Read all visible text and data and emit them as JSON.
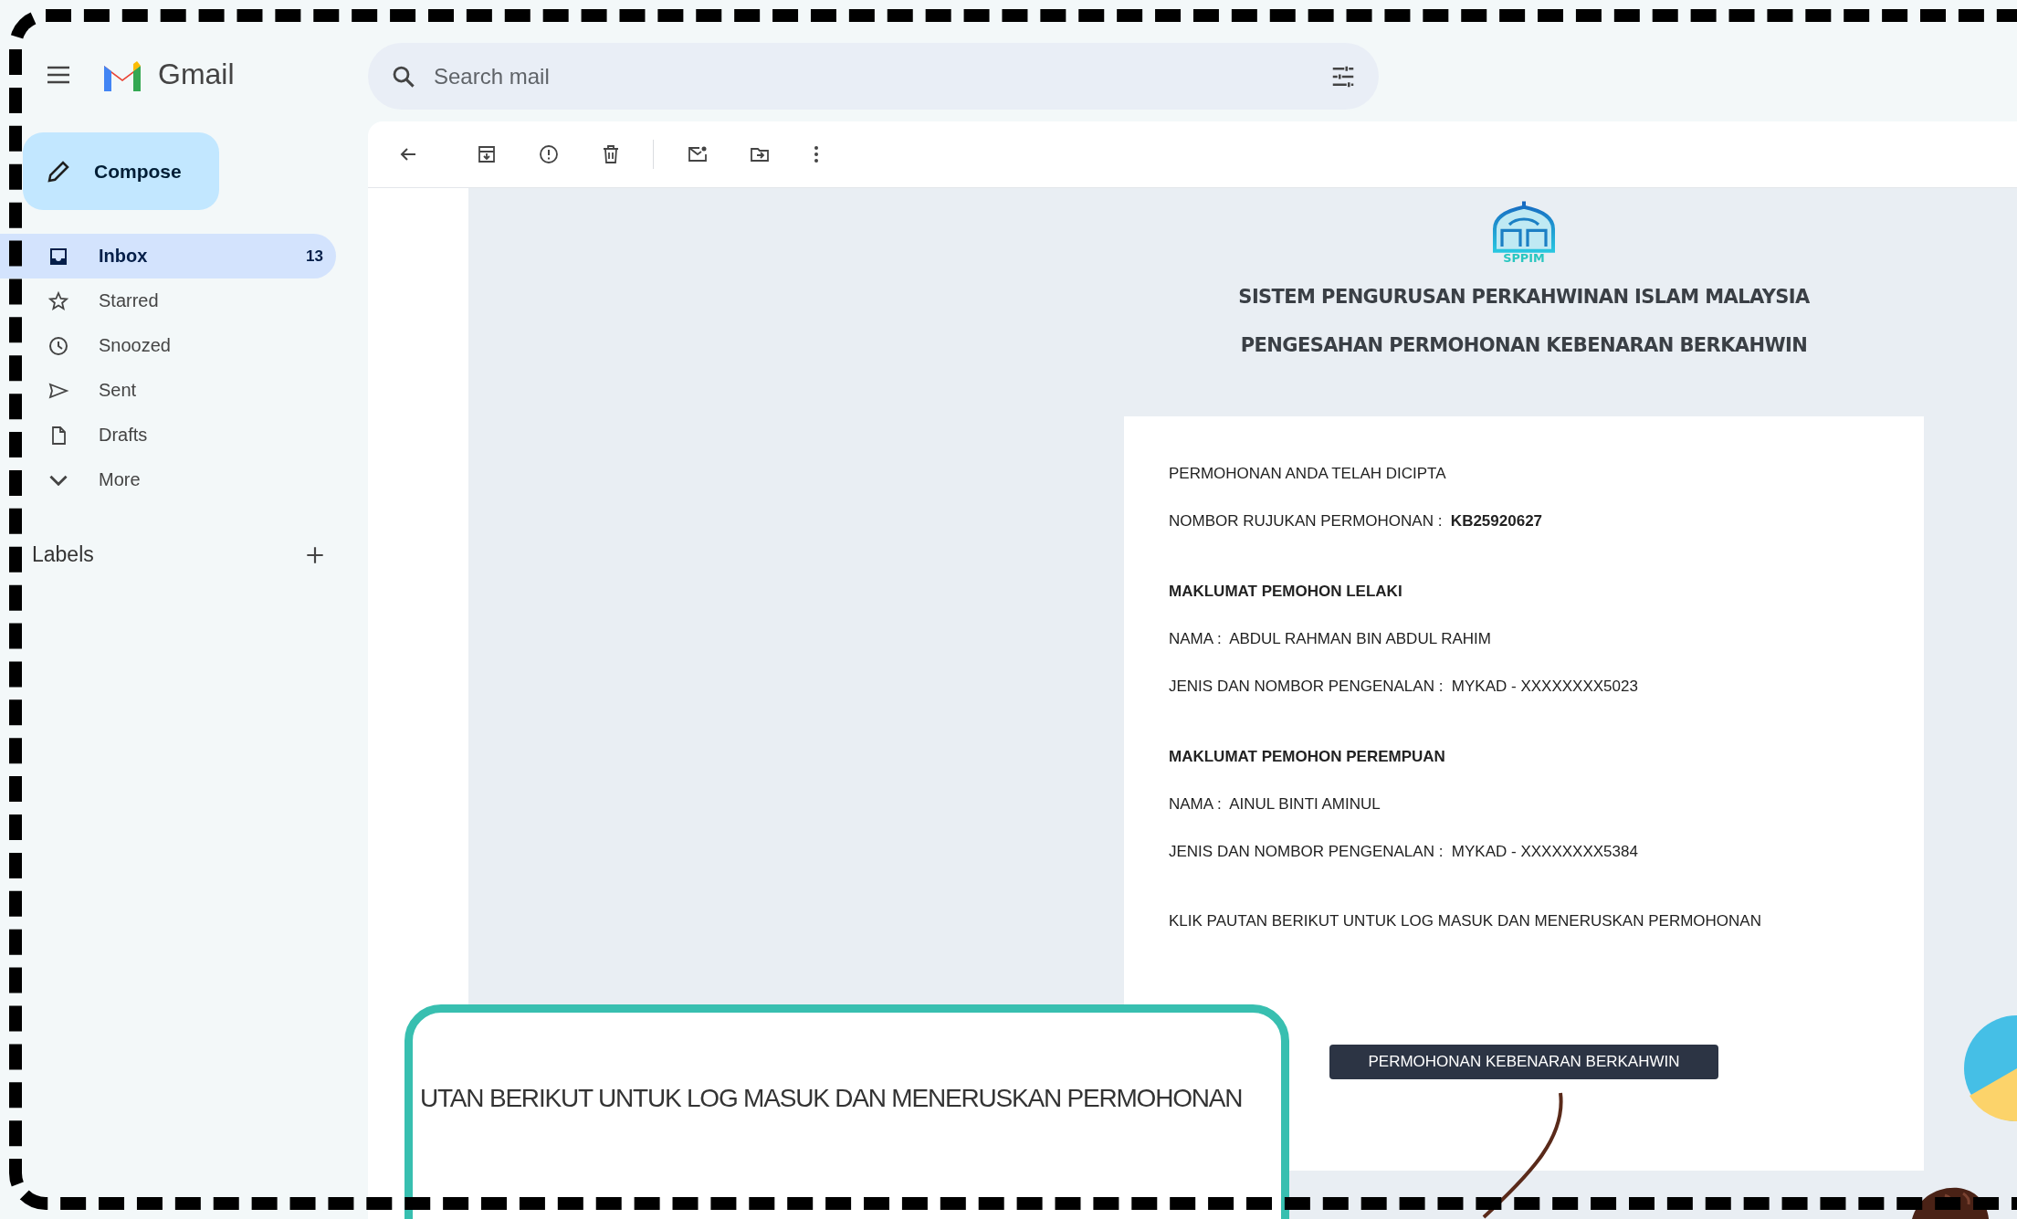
{
  "app": {
    "name": "Gmail"
  },
  "search": {
    "placeholder": "Search mail"
  },
  "compose": {
    "label": "Compose"
  },
  "nav": [
    {
      "label": "Inbox",
      "count": "13",
      "selected": true
    },
    {
      "label": "Starred",
      "selected": false
    },
    {
      "label": "Snoozed",
      "selected": false
    },
    {
      "label": "Sent",
      "selected": false
    },
    {
      "label": "Drafts",
      "selected": false
    },
    {
      "label": "More",
      "selected": false
    }
  ],
  "labels": {
    "title": "Labels"
  },
  "email": {
    "logo_text": "SPPIM",
    "headings": [
      "SISTEM PENGURUSAN PERKAHWINAN ISLAM MALAYSIA",
      "PENGESAHAN PERMOHONAN KEBENARAN BERKAHWIN"
    ],
    "lines": [
      {
        "kind": "text",
        "text": "PERMOHONAN ANDA TELAH DICIPTA"
      },
      {
        "kind": "text",
        "text": "NOMBOR RUJUKAN PERMOHONAN :  **KB25920627**"
      },
      {
        "kind": "heading",
        "text": "MAKLUMAT PEMOHON LELAKI"
      },
      {
        "kind": "text",
        "text": "NAMA :  ABDUL RAHMAN BIN ABDUL RAHIM"
      },
      {
        "kind": "text",
        "text": "JENIS DAN NOMBOR PENGENALAN :  MYKAD - XXXXXXXX5023"
      },
      {
        "kind": "heading",
        "text": "MAKLUMAT PEMOHON PEREMPUAN"
      },
      {
        "kind": "text",
        "text": "NAMA :  AINUL BINTI AMINUL"
      },
      {
        "kind": "text",
        "text": "JENIS DAN NOMBOR PENGENALAN :  MYKAD - XXXXXXXX5384"
      },
      {
        "kind": "note",
        "text": "KLIK PAUTAN BERIKUT UNTUK LOG MASUK DAN MENERUSKAN PERMOHONAN"
      }
    ],
    "button": "PERMOHONAN KEBENARAN BERKAHWIN"
  },
  "callout": {
    "text": "UTAN BERIKUT UNTUK LOG MASUK DAN MENERUSKAN PERMOHONAN"
  }
}
